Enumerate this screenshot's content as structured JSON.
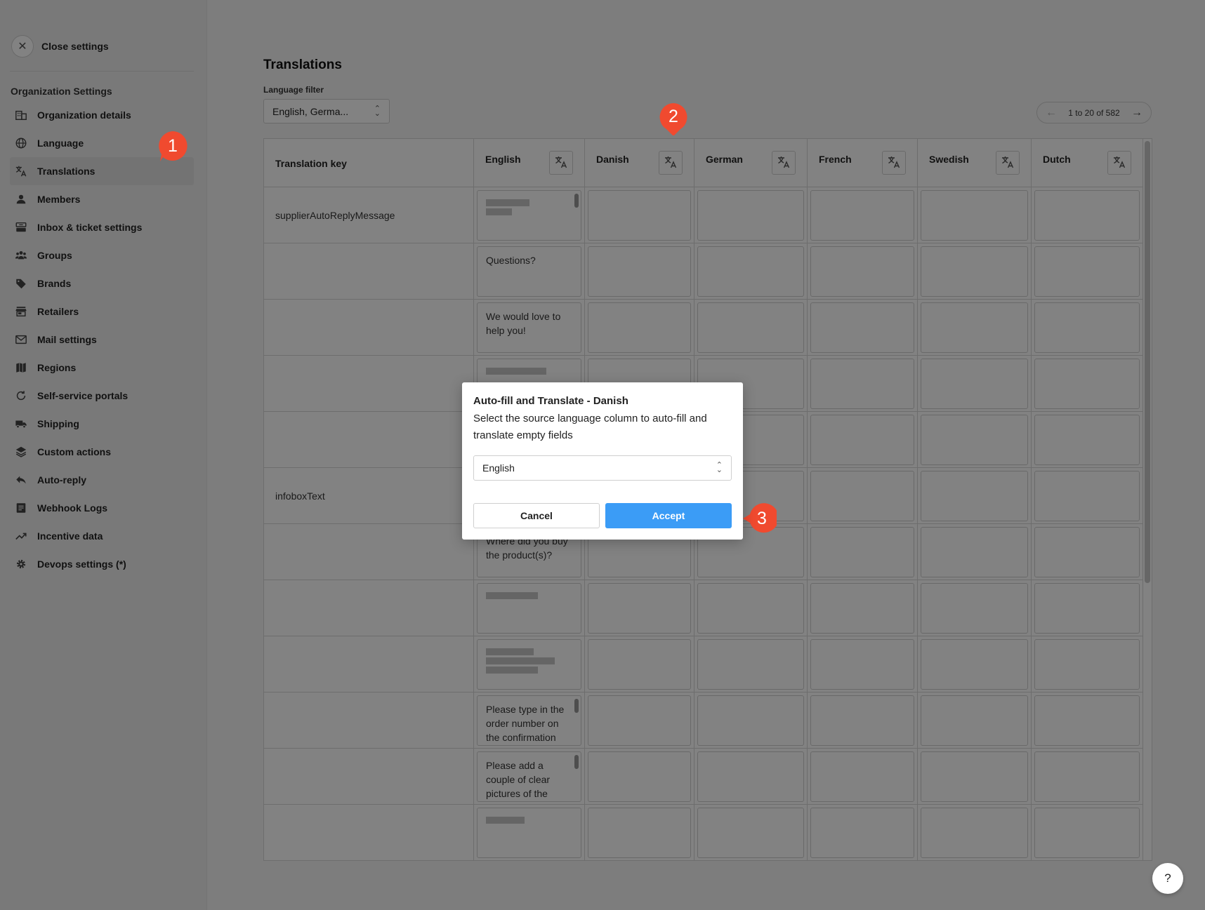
{
  "sidebar": {
    "close_label": "Close settings",
    "section_title": "Organization Settings",
    "items": [
      {
        "label": "Organization details",
        "icon": "building-icon"
      },
      {
        "label": "Language",
        "icon": "globe-icon"
      },
      {
        "label": "Translations",
        "icon": "translate-icon",
        "active": true
      },
      {
        "label": "Members",
        "icon": "person-icon"
      },
      {
        "label": "Inbox & ticket settings",
        "icon": "inbox-icon"
      },
      {
        "label": "Groups",
        "icon": "groups-icon"
      },
      {
        "label": "Brands",
        "icon": "tag-icon"
      },
      {
        "label": "Retailers",
        "icon": "store-icon"
      },
      {
        "label": "Mail settings",
        "icon": "mail-icon"
      },
      {
        "label": "Regions",
        "icon": "map-icon"
      },
      {
        "label": "Self-service portals",
        "icon": "refresh-icon"
      },
      {
        "label": "Shipping",
        "icon": "truck-icon"
      },
      {
        "label": "Custom actions",
        "icon": "layers-icon"
      },
      {
        "label": "Auto-reply",
        "icon": "reply-icon"
      },
      {
        "label": "Webhook Logs",
        "icon": "log-icon"
      },
      {
        "label": "Incentive data",
        "icon": "trending-icon"
      },
      {
        "label": "Devops settings (*)",
        "icon": "gear-icon"
      }
    ]
  },
  "main": {
    "title": "Translations",
    "filter_label": "Language filter",
    "filter_value": "English, Germa...",
    "pager_text": "1 to 20 of 582"
  },
  "table": {
    "key_header": "Translation key",
    "languages": [
      "English",
      "Danish",
      "German",
      "French",
      "Swedish",
      "Dutch"
    ],
    "rows": [
      {
        "key": "supplierAutoReplyMessage",
        "english": ""
      },
      {
        "key": "",
        "english": "Questions?"
      },
      {
        "key": "",
        "english": "We would love to help you!"
      },
      {
        "key": "",
        "english": ""
      },
      {
        "key": "",
        "english": ""
      },
      {
        "key": "infoboxText",
        "english": ""
      },
      {
        "key": "",
        "english": "Where did you buy the product(s)?"
      },
      {
        "key": "",
        "english": ""
      },
      {
        "key": "",
        "english": ""
      },
      {
        "key": "",
        "english": "Please type in the order number on the confirmation"
      },
      {
        "key": "",
        "english": "Please add a couple of clear pictures of the"
      },
      {
        "key": "",
        "english": ""
      }
    ]
  },
  "modal": {
    "title": "Auto-fill and Translate - Danish",
    "description": "Select the source language column to auto-fill and translate empty fields",
    "select_value": "English",
    "cancel_label": "Cancel",
    "accept_label": "Accept"
  },
  "markers": [
    "1",
    "2",
    "3"
  ],
  "help_label": "?",
  "colors": {
    "accent": "#3b9cf6",
    "marker": "#f04a2f"
  }
}
